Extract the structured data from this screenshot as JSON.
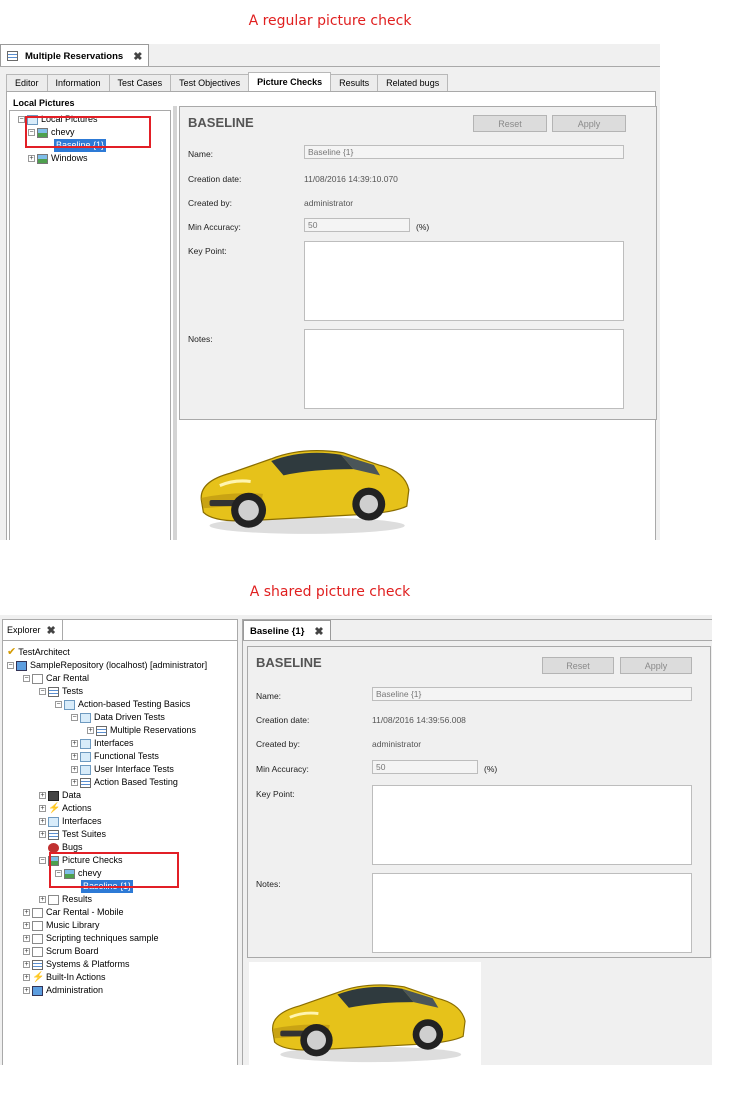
{
  "top": {
    "caption": "A regular picture check",
    "window_title": "Multiple Reservations",
    "tabs": [
      "Editor",
      "Information",
      "Test Cases",
      "Test Objectives",
      "Picture Checks",
      "Results",
      "Related bugs"
    ],
    "active_tab": "Picture Checks",
    "local_pictures_heading": "Local Pictures",
    "tree": {
      "root": "Local Pictures",
      "chevy": "chevy",
      "baseline": "Baseline {1}",
      "windows": "Windows"
    },
    "detail": {
      "title": "BASELINE",
      "reset": "Reset",
      "apply": "Apply",
      "name_label": "Name:",
      "name_value": "Baseline {1}",
      "creation_label": "Creation date:",
      "creation_value": "11/08/2016 14:39:10.070",
      "created_by_label": "Created by:",
      "created_by_value": "administrator",
      "min_acc_label": "Min Accuracy:",
      "min_acc_value": "50",
      "percent": "(%)",
      "key_point_label": "Key Point:",
      "notes_label": "Notes:"
    }
  },
  "bottom": {
    "caption": "A shared picture check",
    "explorer_title": "Explorer",
    "editor_title": "Baseline {1}",
    "tree": {
      "testarchitect": "TestArchitect",
      "repo": "SampleRepository (localhost) [administrator]",
      "car_rental": "Car Rental",
      "tests": "Tests",
      "action_based_basics": "Action-based Testing Basics",
      "data_driven": "Data Driven Tests",
      "multiple_reservations": "Multiple Reservations",
      "interfaces_sub": "Interfaces",
      "functional": "Functional Tests",
      "ui_tests": "User Interface Tests",
      "action_based_testing": "Action Based Testing",
      "data": "Data",
      "actions": "Actions",
      "interfaces": "Interfaces",
      "test_suites": "Test Suites",
      "bugs": "Bugs",
      "picture_checks": "Picture Checks",
      "chevy": "chevy",
      "baseline": "Baseline {1}",
      "results": "Results",
      "car_rental_mobile": "Car Rental - Mobile",
      "music_library": "Music Library",
      "scripting": "Scripting techniques sample",
      "scrum": "Scrum Board",
      "systems": "Systems & Platforms",
      "builtin": "Built-In Actions",
      "administration": "Administration"
    },
    "detail": {
      "title": "BASELINE",
      "reset": "Reset",
      "apply": "Apply",
      "name_label": "Name:",
      "name_value": "Baseline {1}",
      "creation_label": "Creation date:",
      "creation_value": "11/08/2016 14:39:56.008",
      "created_by_label": "Created by:",
      "created_by_value": "administrator",
      "min_acc_label": "Min Accuracy:",
      "min_acc_value": "50",
      "percent": "(%)",
      "key_point_label": "Key Point:",
      "notes_label": "Notes:"
    }
  },
  "colors": {
    "caption": "#e02020",
    "highlight_box": "#e21f26",
    "selection": "#2d7ad6",
    "car_body": "#e6c21a"
  }
}
